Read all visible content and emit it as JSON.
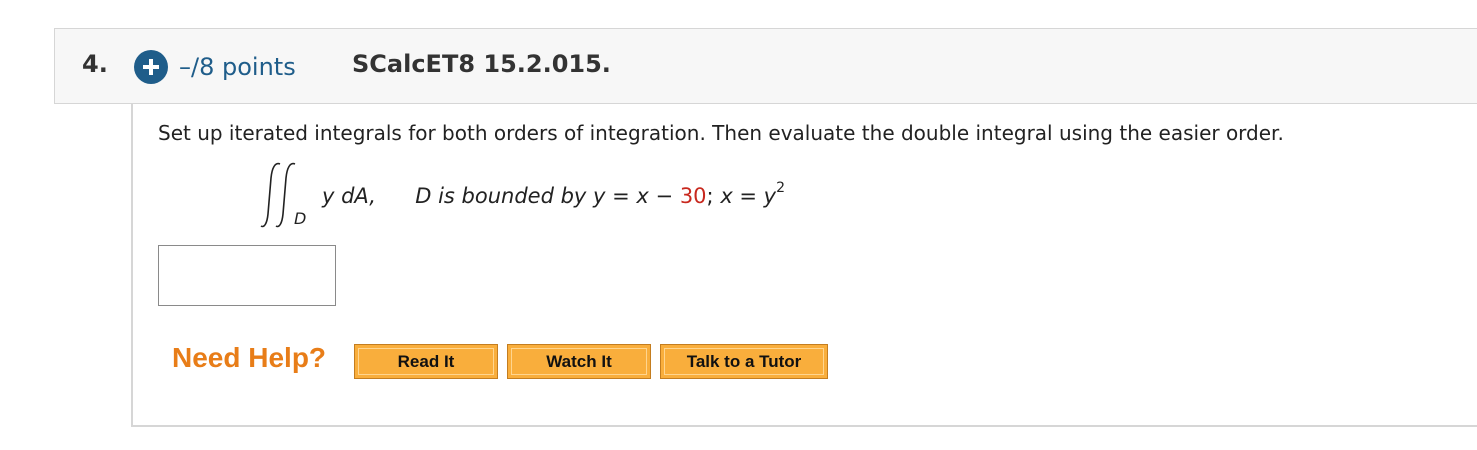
{
  "question": {
    "number": "4.",
    "points": "–/8 points",
    "problem_id": "SCalcET8 15.2.015."
  },
  "icons": {
    "expand": "plus-circle-icon",
    "integral": "double-integral-icon"
  },
  "colors": {
    "points_blue": "#1f5d8a",
    "help_orange": "#e87d18",
    "button_orange": "#f9ae3c",
    "highlight_red": "#c8281e"
  },
  "problem": {
    "instructions": "Set up iterated integrals for both orders of integration. Then evaluate the double integral using the easier order.",
    "integral_subscript": "D",
    "integrand": "y dA,",
    "region_prefix": "D is bounded by",
    "eq1_lhs": "y = x −",
    "eq1_value": "30",
    "separator": ";",
    "eq2_lhs": "x = y",
    "eq2_exponent": "2"
  },
  "answer": {
    "value": ""
  },
  "help": {
    "label": "Need Help?",
    "read_it": "Read It",
    "watch_it": "Watch It",
    "talk_to_tutor": "Talk to a Tutor"
  }
}
